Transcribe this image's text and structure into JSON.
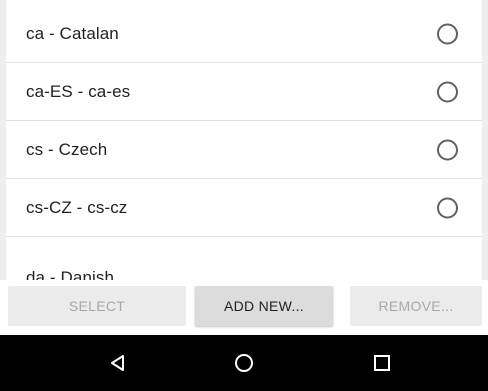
{
  "list": {
    "items": [
      {
        "label": "ca - Catalan",
        "selected": false
      },
      {
        "label": "ca-ES - ca-es",
        "selected": false
      },
      {
        "label": "cs - Czech",
        "selected": false
      },
      {
        "label": "cs-CZ - cs-cz",
        "selected": false
      },
      {
        "label": "da - Danish",
        "selected": false
      }
    ]
  },
  "buttons": {
    "select": "SELECT",
    "add_new": "ADD NEW...",
    "remove": "REMOVE..."
  },
  "navbar": {
    "icons": [
      "back-icon",
      "home-icon",
      "recents-icon"
    ]
  },
  "colors": {
    "text_primary": "#212121",
    "text_disabled": "#a8a8a8",
    "radio": "#616161",
    "navbar": "#000000"
  }
}
